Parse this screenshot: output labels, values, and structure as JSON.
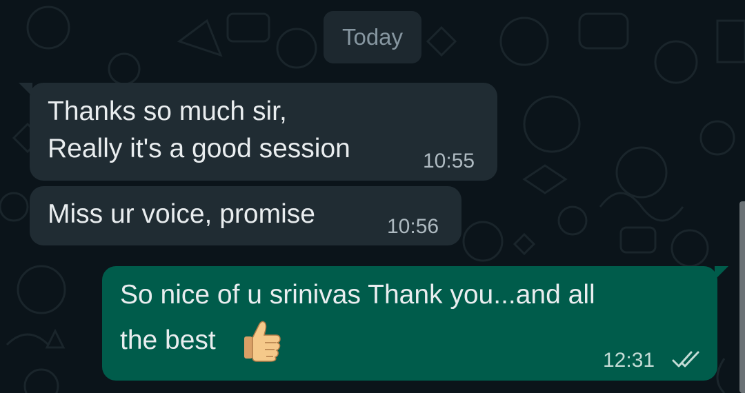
{
  "date_chip": {
    "label": "Today"
  },
  "messages": [
    {
      "direction": "incoming",
      "lines": [
        "Thanks so much sir,",
        "Really it's a good session"
      ],
      "time": "10:55"
    },
    {
      "direction": "incoming",
      "lines": [
        "Miss ur voice, promise"
      ],
      "time": "10:56"
    },
    {
      "direction": "outgoing",
      "lines": [
        "So nice of u srinivas   Thank you...and all",
        "the best"
      ],
      "emoji": "thumbs-up",
      "time": "12:31",
      "status": "read-double-tick"
    }
  ],
  "colors": {
    "background": "#0b141a",
    "incoming_bubble": "#202c33",
    "outgoing_bubble": "#005c4b",
    "date_chip": "#1d282f",
    "text": "#e9edef",
    "timestamp": "#aebac1"
  }
}
